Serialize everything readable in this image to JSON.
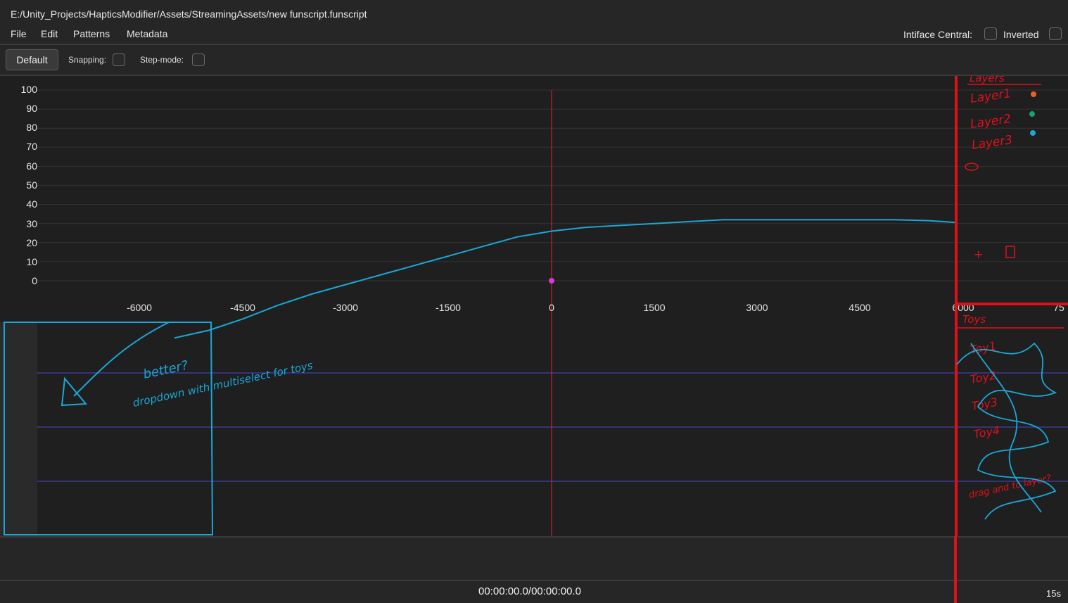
{
  "window": {
    "title": "E:/Unity_Projects/HapticsModifier/Assets/StreamingAssets/new funscript.funscript"
  },
  "menu": {
    "items": [
      "File",
      "Edit",
      "Patterns",
      "Metadata"
    ]
  },
  "options": {
    "intiface_label": "Intiface Central:",
    "inverted_label": "Inverted"
  },
  "toolbar": {
    "default_label": "Default",
    "snapping_label": "Snapping:",
    "step_mode_label": "Step-mode:"
  },
  "graph": {
    "y_ticks": [
      "100",
      "90",
      "80",
      "70",
      "60",
      "50",
      "40",
      "30",
      "20",
      "10",
      "0"
    ],
    "x_ticks": [
      "-6000",
      "-4500",
      "-3000",
      "-1500",
      "0",
      "1500",
      "3000",
      "4500",
      "6000",
      "75"
    ]
  },
  "chart_data": {
    "type": "line",
    "x": [
      -5500,
      -5000,
      -4500,
      -4000,
      -3500,
      -3000,
      -2500,
      -2000,
      -1500,
      -1000,
      -500,
      0,
      500,
      1000,
      1500,
      2000,
      2500,
      3000,
      3500,
      4000,
      4500,
      5000,
      5500,
      5900
    ],
    "y": [
      -30,
      -26,
      -20,
      -13,
      -7,
      -2,
      3,
      8,
      13,
      18,
      23,
      26,
      28,
      29,
      30,
      31,
      32,
      32,
      32,
      32,
      32,
      32,
      31.5,
      30.5
    ],
    "ylim": [
      0,
      100
    ],
    "xticks": [
      -6000,
      -4500,
      -3000,
      -1500,
      0,
      1500,
      3000,
      4500,
      6000
    ],
    "grid": true,
    "line_color": "#1aa7d6",
    "playhead_color": "#e0203a",
    "marker_color": "#d63ad6"
  },
  "annotations": {
    "layers_title": "Layers",
    "layers": [
      "Layer1",
      "Layer2",
      "Layer3"
    ],
    "layer_colors": [
      "#f06020",
      "#1f9e6e",
      "#1aa7d6"
    ],
    "toys_title": "Toys",
    "toys": [
      "Toy1",
      "Toy2",
      "Toy3",
      "Toy4"
    ],
    "note_better": "better?",
    "note_dropdown": "dropdown with multiselect for toys",
    "note_drag": "drag and to layer?"
  },
  "status": {
    "timecode": "00:00:00.0/00:00:00.0",
    "zoom": "15s"
  }
}
